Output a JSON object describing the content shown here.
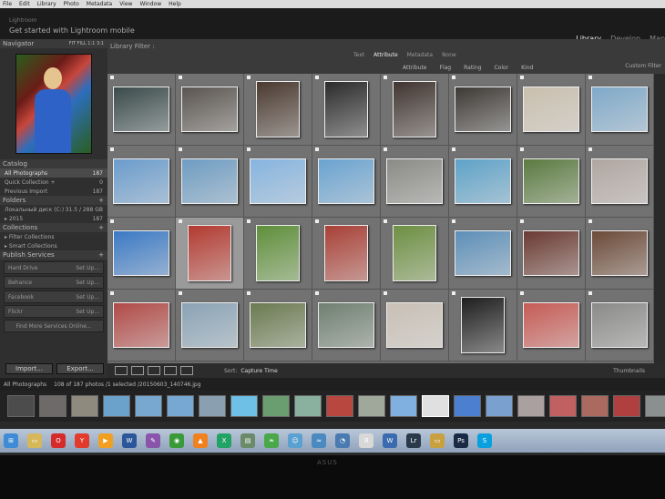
{
  "menu": [
    "File",
    "Edit",
    "Library",
    "Photo",
    "Metadata",
    "View",
    "Window",
    "Help"
  ],
  "identity": {
    "small": "Lightroom",
    "subtitle": "Get started with Lightroom mobile"
  },
  "modules": [
    {
      "label": "Library",
      "active": true
    },
    {
      "label": "Develop",
      "active": false
    },
    {
      "label": "Map",
      "active": false
    }
  ],
  "navigator": {
    "title": "Navigator",
    "zoom": [
      "FIT",
      "FILL",
      "1:1",
      "3:1"
    ]
  },
  "catalog": {
    "title": "Catalog",
    "items": [
      {
        "label": "All Photographs",
        "count": "187",
        "selected": true
      },
      {
        "label": "Quick Collection +",
        "count": "0",
        "selected": false
      },
      {
        "label": "Previous Import",
        "count": "187",
        "selected": false
      }
    ]
  },
  "folders": {
    "title": "Folders",
    "drive": "Локальный диск (C:)",
    "drive_space": "31.5 / 288 GB",
    "items": [
      {
        "label": "2015",
        "count": "187"
      }
    ]
  },
  "collections": {
    "title": "Collections",
    "items": [
      {
        "label": "Filter Collections"
      },
      {
        "label": "Smart Collections"
      }
    ]
  },
  "publish": {
    "title": "Publish Services",
    "items": [
      {
        "label": "Hard Drive",
        "action": "Set Up..."
      },
      {
        "label": "Behance",
        "action": "Set Up..."
      },
      {
        "label": "Facebook",
        "action": "Set Up..."
      },
      {
        "label": "Flickr",
        "action": "Set Up..."
      }
    ],
    "find_more": "Find More Services Online..."
  },
  "buttons": {
    "import": "Import...",
    "export": "Export..."
  },
  "filter": {
    "label": "Library Filter :",
    "tabs": [
      {
        "label": "Text",
        "on": false
      },
      {
        "label": "Attribute",
        "on": true
      },
      {
        "label": "Metadata",
        "on": false
      },
      {
        "label": "None",
        "on": false
      }
    ],
    "sub": [
      "Attribute",
      "Flag",
      "Rating",
      "Color",
      "Kind"
    ],
    "custom": "Custom Filter"
  },
  "toolbar": {
    "sort_label": "Sort:",
    "sort_value": "Capture Time",
    "thumb_label": "Thumbnails"
  },
  "filmstrip_header": {
    "source": "All Photographs",
    "info": "108 of 187 photos /1 selected /20150603_140746.jpg"
  },
  "grid": [
    [
      "#3a4a4a",
      "#5a5550",
      "#4a3a30",
      "#2b2b2b",
      "#403530",
      "#3d3935",
      "#c9bfae",
      "#7fa9c9"
    ],
    [
      "#6a9ccc",
      "#6e9cc2",
      "#86b4df",
      "#6aa3d0",
      "#8a8a86",
      "#5ea2c8",
      "#5b7a40",
      "#b0a6a0"
    ],
    [
      "#3b79c4",
      "#b23a30",
      "#5f8f3a",
      "#a84036",
      "#6d8f42",
      "#5d8fb8",
      "#6a3a32",
      "#6b4a38"
    ],
    [
      "#b04a46",
      "#8aa3b5",
      "#6a7a50",
      "#6f7f70",
      "#c9c0b6",
      "#1e1e1e",
      "#c65b55",
      "#8a8a88"
    ]
  ],
  "filmstrip": [
    "#4c4c4c",
    "#6e6a6a",
    "#8f8a7e",
    "#6aa2cc",
    "#78a7cf",
    "#77a8d3",
    "#8aa0b0",
    "#6ec0e6",
    "#6a9d70",
    "#8ab0a0",
    "#b84740",
    "#9fa89a",
    "#7fb0df",
    "#e0e0e0",
    "#4c7fd0",
    "#7aa0d0",
    "#aaa0a0",
    "#c06060",
    "#aa6a60",
    "#b04040",
    "#8a9090",
    "#a04848",
    "#aa8a80"
  ],
  "taskbar": [
    {
      "icon": "windows-start-icon",
      "color": "#3f8bd5",
      "t": "⊞"
    },
    {
      "icon": "folder-icon",
      "color": "#d6b85a",
      "t": "▭"
    },
    {
      "icon": "opera-icon",
      "color": "#d52b2b",
      "t": "O"
    },
    {
      "icon": "yandex-icon",
      "color": "#e23b2b",
      "t": "Y"
    },
    {
      "icon": "play-icon",
      "color": "#f0a020",
      "t": "▶"
    },
    {
      "icon": "word-icon",
      "color": "#2b579a",
      "t": "W"
    },
    {
      "icon": "paint-icon",
      "color": "#8855aa",
      "t": "✎"
    },
    {
      "icon": "chrome-icon",
      "color": "#3a9a3a",
      "t": "◉"
    },
    {
      "icon": "vlc-icon",
      "color": "#f08020",
      "t": "▲"
    },
    {
      "icon": "excel-icon",
      "color": "#21a366",
      "t": "X"
    },
    {
      "icon": "printer-icon",
      "color": "#6a8a6a",
      "t": "▤"
    },
    {
      "icon": "leaf-icon",
      "color": "#4aa84a",
      "t": "❧"
    },
    {
      "icon": "people-icon",
      "color": "#5aa0d0",
      "t": "☺"
    },
    {
      "icon": "wifi-icon",
      "color": "#4a8ac0",
      "t": "≈"
    },
    {
      "icon": "media-player-icon",
      "color": "#4a7ab0",
      "t": "◔"
    },
    {
      "icon": "yandex-browser-icon",
      "color": "#d8d8d8",
      "t": "Я"
    },
    {
      "icon": "word-blue-icon",
      "color": "#3a6ab0",
      "t": "W"
    },
    {
      "icon": "lightroom-icon",
      "color": "#2a3a4a",
      "t": "Lr"
    },
    {
      "icon": "explorer-icon",
      "color": "#c8a040",
      "t": "▭"
    },
    {
      "icon": "photoshop-icon",
      "color": "#1a2a44",
      "t": "Ps"
    },
    {
      "icon": "skype-icon",
      "color": "#0aa0e0",
      "t": "S"
    }
  ],
  "monitor_brand": "ASUS"
}
